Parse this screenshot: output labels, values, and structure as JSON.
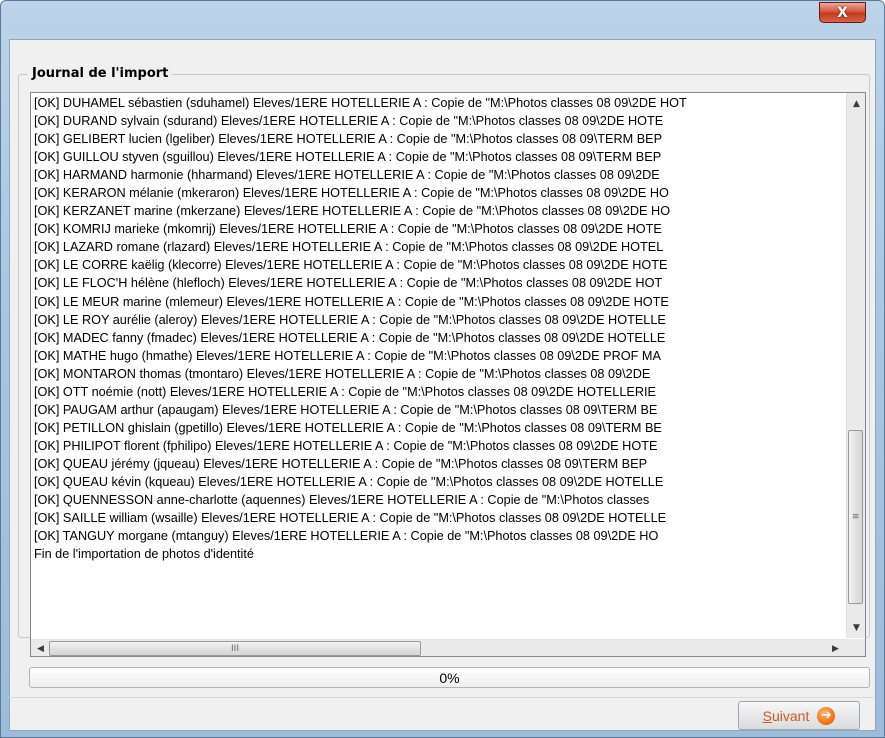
{
  "window": {
    "close_glyph": "X",
    "accent_color": "#a9c6e2"
  },
  "log": {
    "title": "Journal de l'import",
    "lines": [
      "[OK] DUHAMEL sébastien (sduhamel) Eleves/1ERE HOTELLERIE A  : Copie de \"M:\\Photos classes 08 09\\2DE HOT",
      "[OK] DURAND sylvain (sdurand) Eleves/1ERE HOTELLERIE A  : Copie de \"M:\\Photos classes 08 09\\2DE HOTE",
      "[OK] GELIBERT lucien (lgeliber) Eleves/1ERE HOTELLERIE A  : Copie de \"M:\\Photos classes 08 09\\TERM BEP",
      "[OK] GUILLOU styven (sguillou) Eleves/1ERE HOTELLERIE A  : Copie de \"M:\\Photos classes 08 09\\TERM BEP",
      "[OK] HARMAND harmonie (hharmand) Eleves/1ERE HOTELLERIE A  : Copie de \"M:\\Photos classes 08 09\\2DE",
      "[OK] KERARON mélanie (mkeraron) Eleves/1ERE HOTELLERIE A  : Copie de \"M:\\Photos classes 08 09\\2DE HO",
      "[OK] KERZANET marine (mkerzane) Eleves/1ERE HOTELLERIE A  : Copie de \"M:\\Photos classes 08 09\\2DE HO",
      "[OK] KOMRIJ marieke (mkomrij) Eleves/1ERE HOTELLERIE A  : Copie de \"M:\\Photos classes 08 09\\2DE HOTE",
      "[OK] LAZARD romane (rlazard) Eleves/1ERE HOTELLERIE A  : Copie de \"M:\\Photos classes 08 09\\2DE HOTEL",
      "[OK] LE CORRE kaëlig (klecorre) Eleves/1ERE HOTELLERIE A  : Copie de \"M:\\Photos classes 08 09\\2DE HOTE",
      "[OK] LE FLOC'H hélène (hlefloch) Eleves/1ERE HOTELLERIE A  : Copie de \"M:\\Photos classes 08 09\\2DE HOT",
      "[OK] LE MEUR marine (mlemeur) Eleves/1ERE HOTELLERIE A  : Copie de \"M:\\Photos classes 08 09\\2DE HOTE",
      "[OK] LE ROY aurélie (aleroy) Eleves/1ERE HOTELLERIE A  : Copie de \"M:\\Photos classes 08 09\\2DE HOTELLE",
      "[OK] MADEC fanny (fmadec) Eleves/1ERE HOTELLERIE A  : Copie de \"M:\\Photos classes 08 09\\2DE HOTELLE",
      "[OK] MATHE hugo (hmathe) Eleves/1ERE HOTELLERIE A  : Copie de \"M:\\Photos classes 08 09\\2DE PROF MA",
      "[OK] MONTARON thomas (tmontaro) Eleves/1ERE HOTELLERIE A  : Copie de \"M:\\Photos classes 08 09\\2DE",
      "[OK] OTT noémie (nott) Eleves/1ERE HOTELLERIE A  : Copie de \"M:\\Photos classes 08 09\\2DE HOTELLERIE",
      "[OK] PAUGAM arthur (apaugam) Eleves/1ERE HOTELLERIE A  : Copie de \"M:\\Photos classes 08 09\\TERM BE",
      "[OK] PETILLON ghislain (gpetillo) Eleves/1ERE HOTELLERIE A  : Copie de \"M:\\Photos classes 08 09\\TERM BE",
      "[OK] PHILIPOT florent (fphilipo) Eleves/1ERE HOTELLERIE A  : Copie de \"M:\\Photos classes 08 09\\2DE HOTE",
      "[OK] QUEAU jérémy (jqueau) Eleves/1ERE HOTELLERIE A  : Copie de \"M:\\Photos classes 08 09\\TERM BEP",
      "[OK] QUEAU kévin (kqueau) Eleves/1ERE HOTELLERIE A  : Copie de \"M:\\Photos classes 08 09\\2DE HOTELLE",
      "[OK] QUENNESSON anne-charlotte (aquennes) Eleves/1ERE HOTELLERIE A  : Copie de \"M:\\Photos classes",
      "[OK] SAILLE william (wsaille) Eleves/1ERE HOTELLERIE A  : Copie de \"M:\\Photos classes 08 09\\2DE HOTELLE",
      "[OK] TANGUY morgane (mtanguy) Eleves/1ERE HOTELLERIE A  : Copie de \"M:\\Photos classes 08 09\\2DE HO",
      "Fin de l'importation de photos d'identité"
    ],
    "scroll": {
      "up_glyph": "▲",
      "down_glyph": "▼",
      "left_glyph": "◀",
      "right_glyph": "▶",
      "v_grip": "≡",
      "h_grip": "III"
    }
  },
  "progress": {
    "label": "0%",
    "value": 0
  },
  "footer": {
    "next_label_underlined": "S",
    "next_label_rest": "uivant",
    "next_icon_glyph": "➔",
    "next_color": "#c85a2c"
  }
}
